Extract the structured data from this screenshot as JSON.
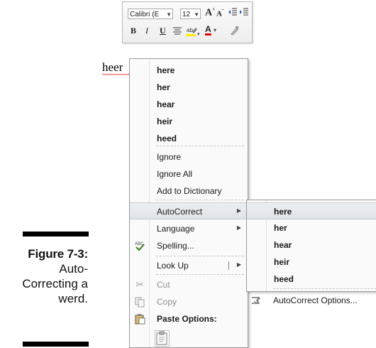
{
  "caption": {
    "figure": "Figure 7-3:",
    "lines": [
      "Auto-",
      "Correcting a",
      "werd."
    ]
  },
  "mini_toolbar": {
    "font_name": "Calibri (E",
    "font_size": "12",
    "grow_font": "A",
    "shrink_font": "A",
    "bold": "B",
    "italic": "I",
    "underline": "U",
    "font_color": "A"
  },
  "document": {
    "misspelled_word": "heer"
  },
  "context_menu": {
    "suggestions": [
      "here",
      "her",
      "hear",
      "heir",
      "heed"
    ],
    "ignore": "Ignore",
    "ignore_all": "Ignore All",
    "add_to_dictionary": "Add to Dictionary",
    "autocorrect": "AutoCorrect",
    "language": "Language",
    "spelling": "Spelling...",
    "look_up": "Look Up",
    "cut": "Cut",
    "copy": "Copy",
    "paste_options": "Paste Options:"
  },
  "autocorrect_submenu": {
    "suggestions": [
      "here",
      "her",
      "hear",
      "heir",
      "heed"
    ],
    "options": "AutoCorrect Options..."
  },
  "colors": {
    "menu_bg": "#fafafa",
    "highlight": "#dfe3e8",
    "squiggle": "#e03030"
  }
}
